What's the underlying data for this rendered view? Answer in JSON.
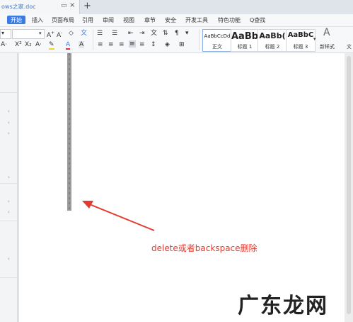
{
  "tabs": {
    "doc_title": "ows之家.doc",
    "monitor_icon": "monitor-icon",
    "close_icon": "close-icon",
    "new_tab_label": "+"
  },
  "menu": {
    "items": [
      "开始",
      "插入",
      "页面布局",
      "引用",
      "审阅",
      "视图",
      "章节",
      "安全",
      "开发工具",
      "特色功能"
    ],
    "search_label": "Q查找"
  },
  "ribbon": {
    "styles": [
      {
        "preview": "AaBbCcDd",
        "name": "正文"
      },
      {
        "preview": "AaBb",
        "name": "标题 1"
      },
      {
        "preview": "AaBb(",
        "name": "标题 2"
      },
      {
        "preview": "AaBbC",
        "name": "标题 3"
      }
    ],
    "new_style_label": "新样式",
    "text_tool_label": "文"
  },
  "annotation": {
    "text": "delete或者backspace删除",
    "color": "#e53a2e"
  },
  "watermark": {
    "text": "广东龙网"
  },
  "colors": {
    "accent": "#3b7be4",
    "highlight": "#f2d22e",
    "font_color": "#e03131"
  }
}
